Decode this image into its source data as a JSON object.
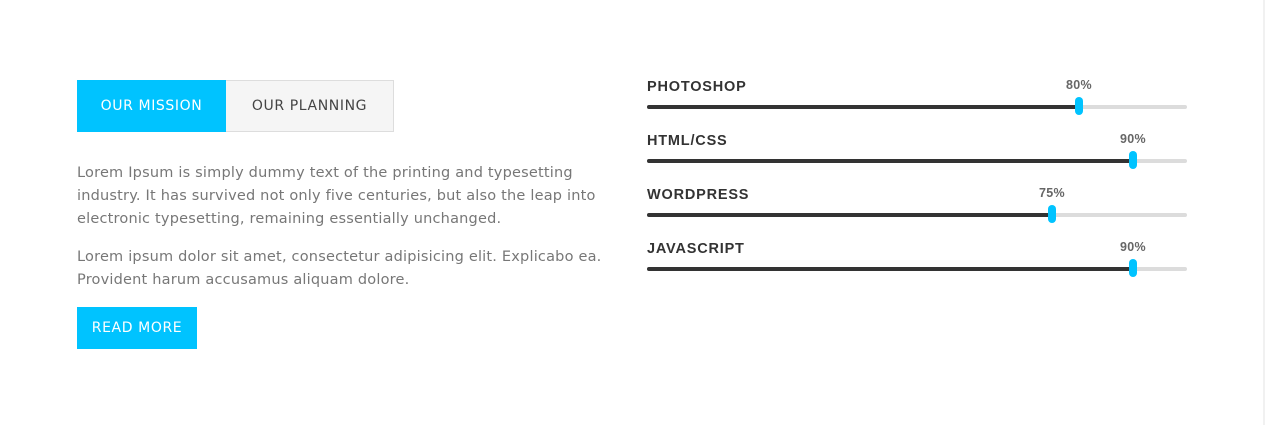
{
  "tabs": [
    {
      "label": "OUR MISSION",
      "active": true
    },
    {
      "label": "OUR PLANNING",
      "active": false
    }
  ],
  "content": {
    "paragraph_1": "Lorem Ipsum is simply dummy text of the printing and typesetting industry. It has survived not only five centuries, but also the leap into electronic typesetting, remaining essentially unchanged.",
    "paragraph_2": "Lorem ipsum dolor sit amet, consectetur adipisicing elit. Explicabo ea. Provident harum accusamus aliquam dolore.",
    "read_more_label": "READ MORE"
  },
  "skills": [
    {
      "name": "PHOTOSHOP",
      "percent_label": "80%",
      "value": 80
    },
    {
      "name": "HTML/CSS",
      "percent_label": "90%",
      "value": 90
    },
    {
      "name": "WORDPRESS",
      "percent_label": "75%",
      "value": 75
    },
    {
      "name": "JAVASCRIPT",
      "percent_label": "90%",
      "value": 90
    }
  ],
  "colors": {
    "accent": "#00c3ff",
    "bar_fill": "#333333",
    "bar_track": "#dcdcdc",
    "body_text": "#777777"
  }
}
